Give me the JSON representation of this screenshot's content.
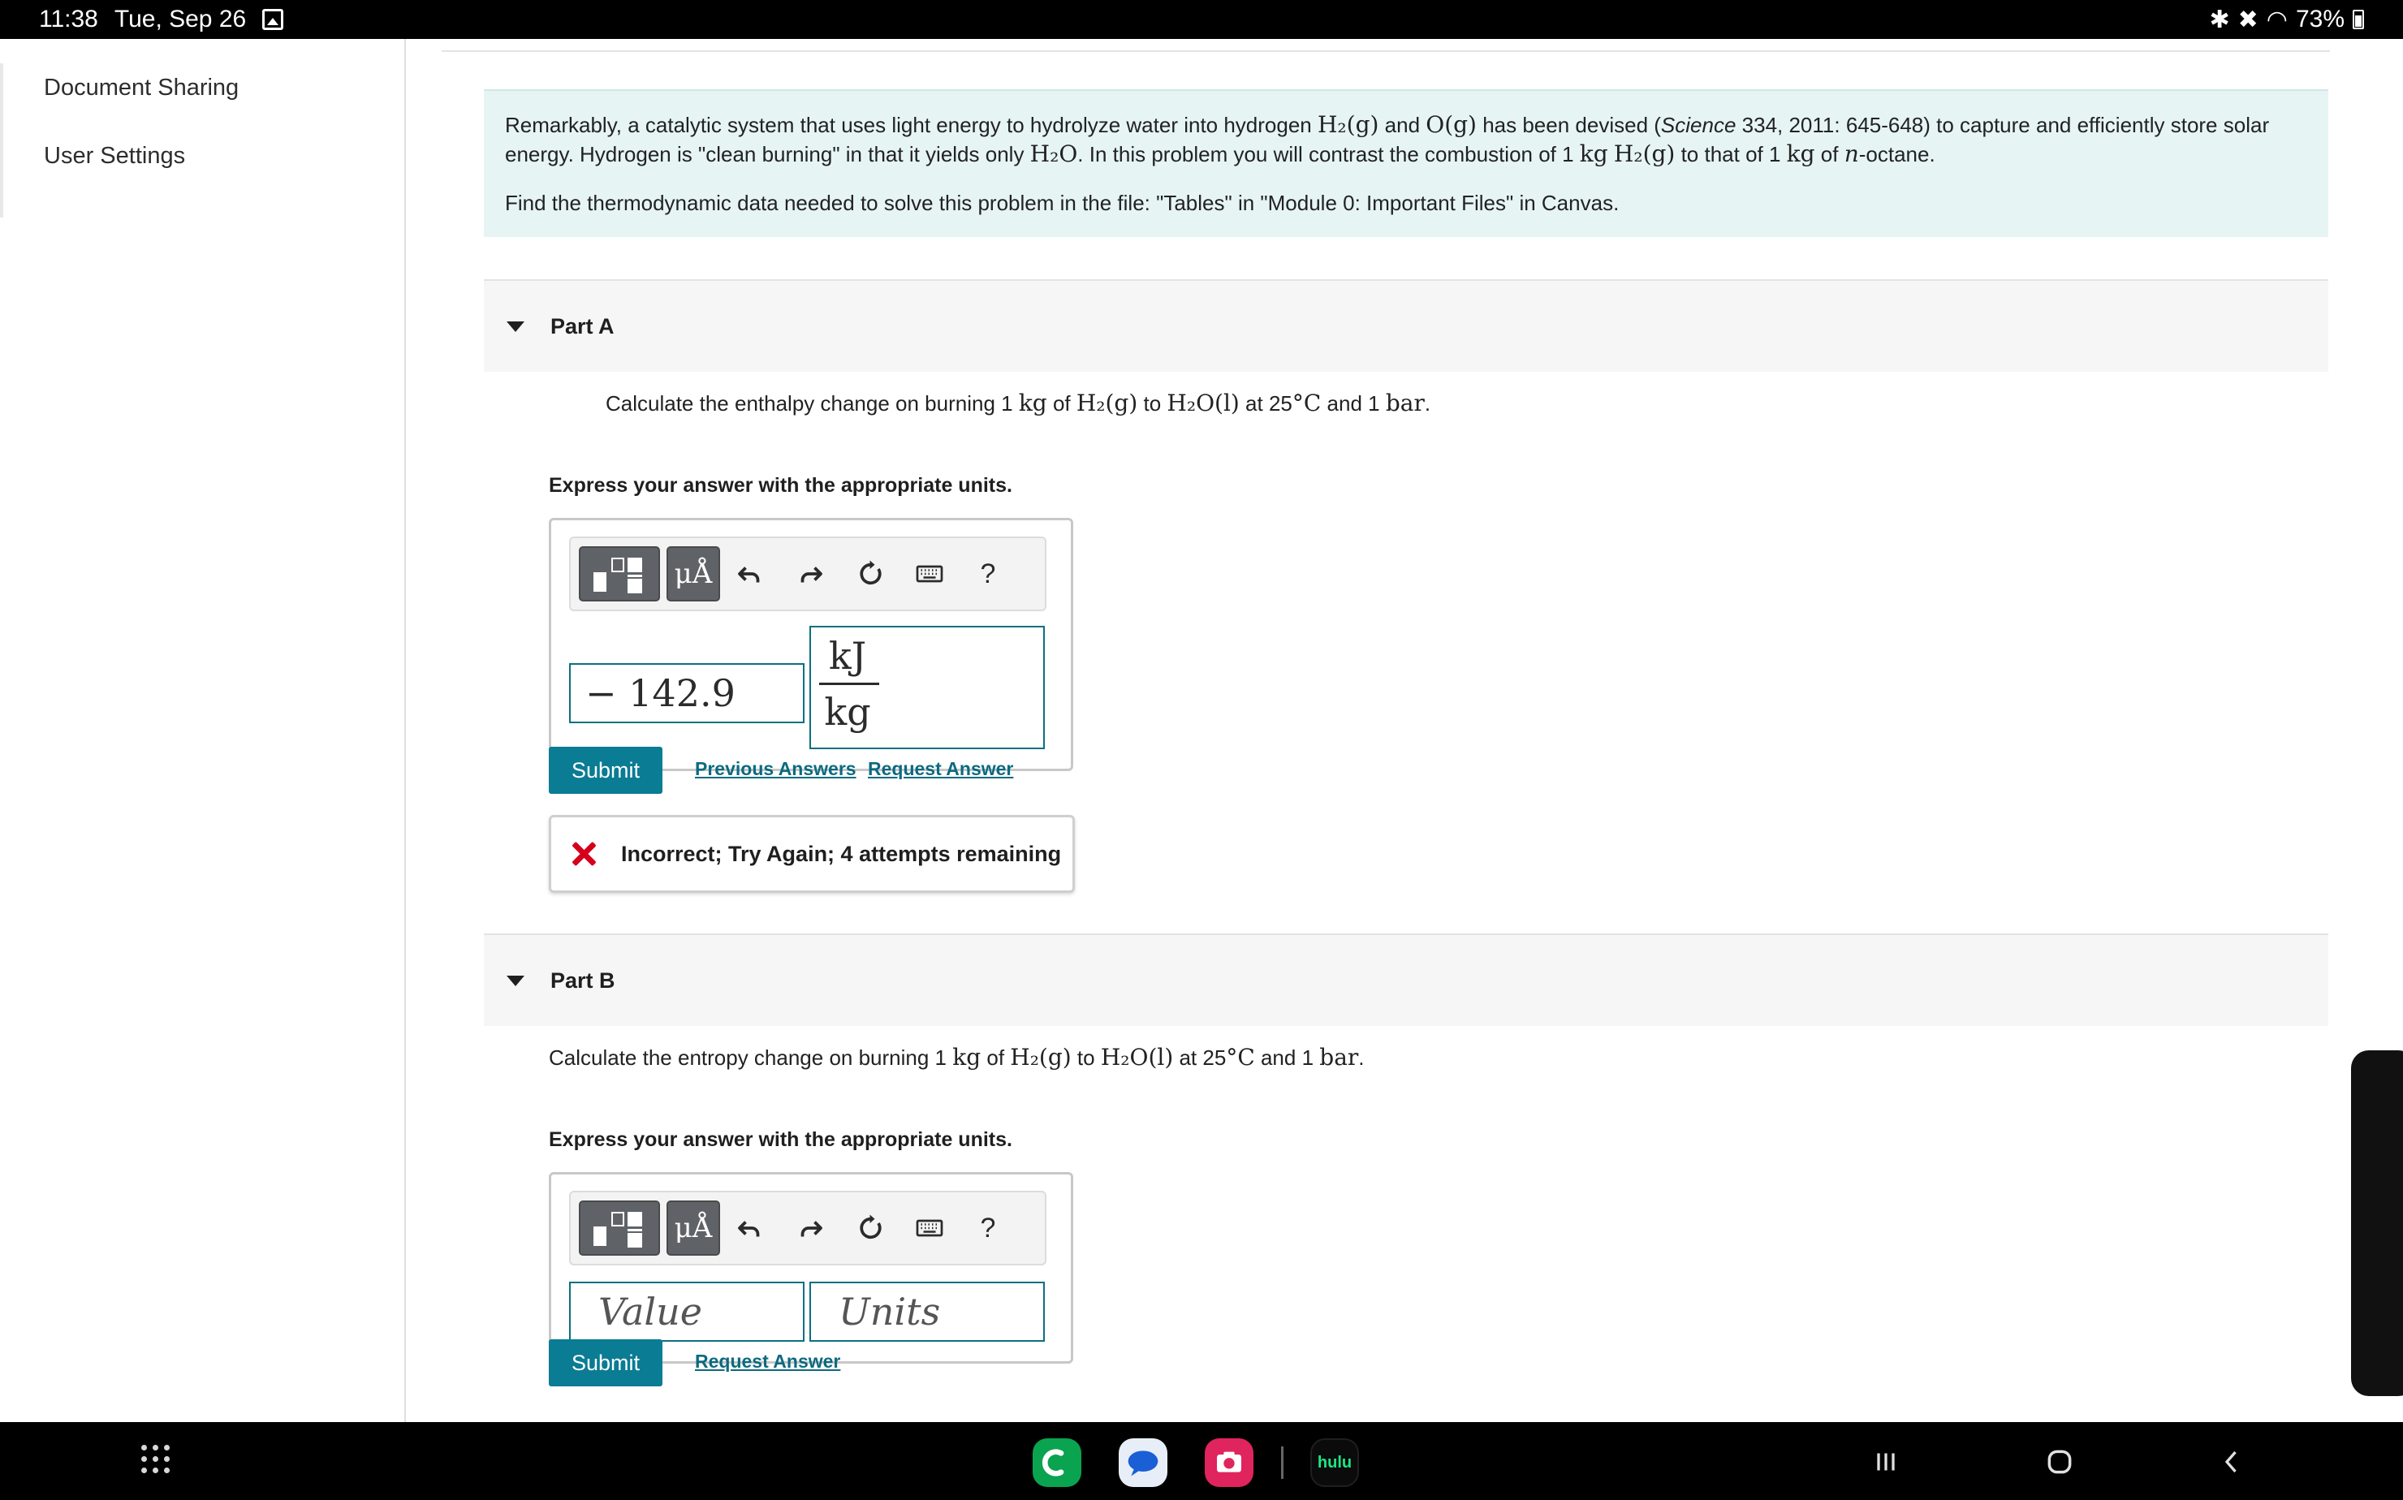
{
  "status_bar": {
    "time": "11:38",
    "date": "Tue, Sep 26",
    "battery": "73%"
  },
  "sidebar": {
    "items": [
      {
        "label": "Document Sharing"
      },
      {
        "label": "User Settings"
      }
    ]
  },
  "intro": {
    "p1_a": "Remarkably, a catalytic system that uses light energy to hydrolyze water into hydrogen ",
    "p1_h2g": "H₂(g)",
    "p1_b": " and ",
    "p1_og": "O(g)",
    "p1_c": " has been devised (",
    "p1_journal": "Science",
    "p1_d": " 334, 2011: 645-648) to capture and efficiently store solar energy. Hydrogen is \"clean burning\" in that it yields only ",
    "p1_h2o": "H₂O",
    "p1_e": ". In this problem you will contrast the combustion of 1 ",
    "p1_kg1": "kg",
    "p1_f": " ",
    "p1_h2g2": "H₂(g)",
    "p1_g": " to that of 1 ",
    "p1_kg2": "kg",
    "p1_h": " of ",
    "p1_n": "n",
    "p1_i": "-octane.",
    "p2": "Find the thermodynamic data needed to solve this problem in the file: \"Tables\" in \"Module 0: Important Files\" in Canvas."
  },
  "part_a": {
    "title": "Part A",
    "q_a": "Calculate the enthalpy change on burning 1 ",
    "q_kg": "kg",
    "q_b": " of ",
    "q_h2g": "H₂(g)",
    "q_c": " to ",
    "q_h2o": "H₂O(l)",
    "q_d": " at 25",
    "q_deg": "°C",
    "q_e": " and 1 ",
    "q_bar": "bar",
    "q_f": ".",
    "instruction": "Express your answer with the appropriate units.",
    "value": "− 142.9",
    "unit_num": "kJ",
    "unit_den": "kg",
    "submit_label": "Submit",
    "prev_answers_label": "Previous Answers",
    "request_answer_label": "Request Answer",
    "feedback": "Incorrect; Try Again; 4 attempts remaining"
  },
  "part_b": {
    "title": "Part B",
    "q_a": "Calculate the entropy change on burning 1 ",
    "q_kg": "kg",
    "q_b": " of ",
    "q_h2g": "H₂(g)",
    "q_c": " to ",
    "q_h2o": "H₂O(l)",
    "q_d": " at 25",
    "q_deg": "°C",
    "q_e": " and 1 ",
    "q_bar": "bar",
    "q_f": ".",
    "instruction": "Express your answer with the appropriate units.",
    "value_placeholder": "Value",
    "units_placeholder": "Units",
    "submit_label": "Submit",
    "request_answer_label": "Request Answer"
  },
  "toolbar": {
    "units_symbol": "μÅ",
    "help_symbol": "?"
  },
  "dock": {
    "hulu_label": "hulu"
  },
  "colors": {
    "accent": "#0a7c93",
    "intro_bg": "#e6f4f4",
    "error": "#d5001c"
  }
}
